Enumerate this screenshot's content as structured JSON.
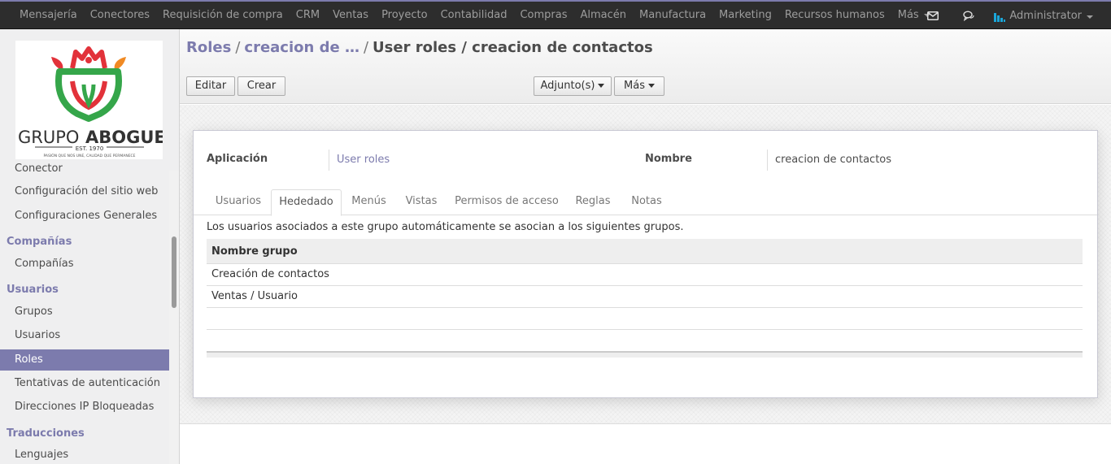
{
  "topbar": {
    "menu": [
      "Mensajería",
      "Conectores",
      "Requisición de compra",
      "CRM",
      "Ventas",
      "Proyecto",
      "Contabilidad",
      "Compras",
      "Almacén",
      "Manufactura",
      "Marketing",
      "Recursos humanos"
    ],
    "more_label": "Más",
    "user_name": "Administrator",
    "icons": [
      "mail-icon",
      "chat-icon"
    ]
  },
  "logo": {
    "text_main": "GRUPO",
    "text_bold": "ABOGUE",
    "est": "EST. 1970",
    "tagline": "PASIÓN QUE NOS UNE, CALIDAD QUE PERMANECE",
    "colors": {
      "red": "#e2323a",
      "green": "#35a64a",
      "orange": "#f08a24"
    }
  },
  "sidebar": {
    "partial_item": "Conector",
    "items_top": [
      "Configuración del sitio web",
      "Configuraciones Generales"
    ],
    "section_companias": "Compañías",
    "items_companias": [
      "Compañías"
    ],
    "section_usuarios": "Usuarios",
    "items_usuarios": [
      "Grupos",
      "Usuarios",
      "Roles",
      "Tentativas de autenticación",
      "Direcciones IP Bloqueadas"
    ],
    "section_traducciones": "Traducciones",
    "items_traducciones": [
      "Lenguajes"
    ],
    "active_item": "Roles"
  },
  "control": {
    "breadcrumb": {
      "root": "Roles",
      "middle": "creacion de …",
      "current": "User roles / creacion de contactos"
    },
    "buttons": {
      "edit": "Editar",
      "create": "Crear",
      "attachments": "Adjunto(s)",
      "more": "Más"
    }
  },
  "form": {
    "application_label": "Aplicación",
    "application_value": "User roles",
    "name_label": "Nombre",
    "name_value": "creacion de contactos",
    "tabs": [
      "Usuarios",
      "Hededado",
      "Menús",
      "Vistas",
      "Permisos de acceso",
      "Reglas",
      "Notas"
    ],
    "active_tab": "Hededado",
    "description": "Los usuarios asociados a este grupo automáticamente se asocian a los siguientes grupos.",
    "table": {
      "header": "Nombre grupo",
      "rows": [
        "Creación de contactos",
        "Ventas / Usuario"
      ]
    }
  },
  "colors": {
    "brand": "#7c7bad",
    "navbar": "#2d2d2d"
  }
}
